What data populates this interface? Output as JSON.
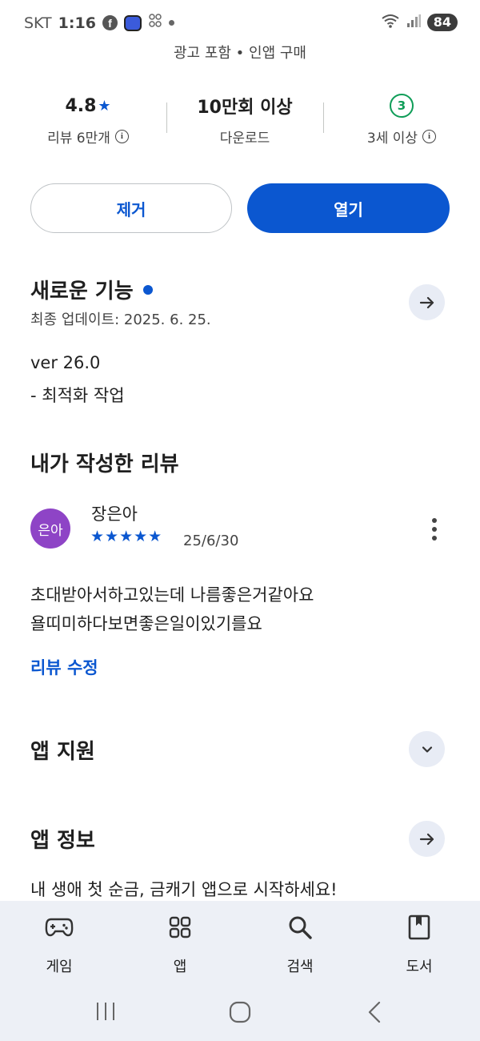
{
  "status_bar": {
    "carrier": "SKT",
    "time": "1:16",
    "battery": "84",
    "icons": [
      "facebook-icon",
      "app-notification-icon",
      "dual-sim-icon",
      "notification-dot",
      "wifi-icon",
      "signal-icon",
      "battery-icon"
    ]
  },
  "app_meta": {
    "ads_line": "광고 포함 • 인앱 구매"
  },
  "stats": {
    "rating": "4.8",
    "rating_label": "리뷰 6만개",
    "downloads": "10만회 이상",
    "downloads_label": "다운로드",
    "age_badge": "3",
    "age_label": "3세 이상",
    "accent_color": "#0b57d0",
    "age_color": "#0f9d58"
  },
  "actions": {
    "remove_label": "제거",
    "open_label": "열기"
  },
  "whats_new": {
    "title": "새로운 기능",
    "updated": "최종 업데이트: 2025. 6. 25.",
    "version": "ver 26.0",
    "notes": "- 최적화 작업"
  },
  "my_review": {
    "section_title": "내가 작성한 리뷰",
    "avatar_text": "은아",
    "reviewer": "장은아",
    "stars": 5,
    "stars_text": "★★★★★",
    "date": "25/6/30",
    "line1": "초대받아서하고있는데 나름좋은거같아요",
    "line2": "욜띠미하다보면좋은일이있기를요",
    "edit_label": "리뷰 수정"
  },
  "app_support": {
    "title": "앱 지원"
  },
  "app_info": {
    "title": "앱 정보",
    "description": "내 생애 첫 순금, 금캐기 앱으로 시작하세요!"
  },
  "bottom_nav": {
    "items": [
      {
        "label": "게임",
        "icon": "gamepad-icon"
      },
      {
        "label": "앱",
        "icon": "apps-grid-icon"
      },
      {
        "label": "검색",
        "icon": "search-icon"
      },
      {
        "label": "도서",
        "icon": "book-icon"
      }
    ]
  },
  "system_nav": {
    "buttons": [
      "recents-icon",
      "home-icon",
      "back-icon"
    ]
  }
}
